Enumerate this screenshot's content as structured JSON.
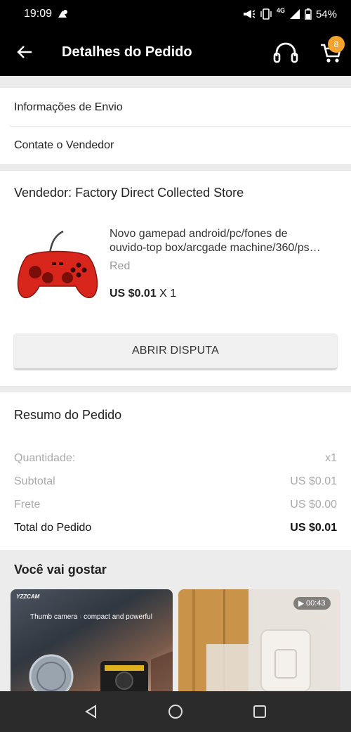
{
  "status_bar": {
    "time": "19:09",
    "network": "4G",
    "battery": "54%"
  },
  "header": {
    "title": "Detalhes do Pedido",
    "cart_count": "8",
    "icons": [
      "back-arrow-icon",
      "headset-icon",
      "cart-icon"
    ]
  },
  "shipping": {
    "info_label": "Informações de Envio",
    "contact_label": "Contate o Vendedor"
  },
  "order": {
    "seller": "Vendedor: Factory Direct Collected Store",
    "product": {
      "title_line1": "Novo gamepad android/pc/fones de",
      "title_line2": "ouvido-top box/arcgade machine/360/ps…",
      "variant": "Red",
      "price": "US $0.01",
      "quantity": "X 1"
    },
    "dispute_button": "ABRIR DISPUTA"
  },
  "summary": {
    "title": "Resumo do Pedido",
    "rows": [
      {
        "label": "Quantidade:",
        "value": "x1"
      },
      {
        "label": "Subtotal",
        "value": "US $0.01"
      },
      {
        "label": "Frete",
        "value": "US $0.00"
      },
      {
        "label": "Total do Pedido",
        "value": "US $0.01"
      }
    ]
  },
  "recommendations": {
    "title": "Você vai gostar",
    "items": [
      {
        "brand": "YZZCAM",
        "caption": "Thumb camera · compact and powerful"
      },
      {
        "video_duration": "00:43"
      }
    ]
  },
  "colors": {
    "header_bg": "#000000",
    "badge": "#f3a32e",
    "page_bg": "#ececec",
    "product_red": "#d9261c"
  }
}
